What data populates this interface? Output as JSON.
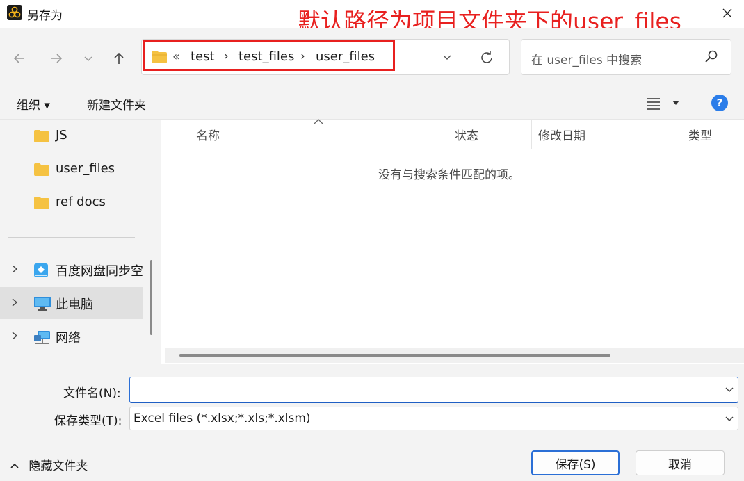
{
  "window": {
    "title": "另存为",
    "close_label": "✕"
  },
  "annotation": {
    "text": "默认路径为项目文件夹下的user_files",
    "color": "#e8201f"
  },
  "address": {
    "overflow": "«",
    "crumbs": [
      "test",
      "test_files",
      "user_files"
    ],
    "separator": "›"
  },
  "search": {
    "placeholder": "在 user_files 中搜索"
  },
  "toolbar": {
    "organize": "组织 ▾",
    "new_folder": "新建文件夹",
    "help": "?"
  },
  "sidebar": {
    "items": [
      {
        "label": "JS",
        "icon": "folder-icon"
      },
      {
        "label": "user_files",
        "icon": "folder-icon"
      },
      {
        "label": "ref docs",
        "icon": "folder-icon"
      },
      {
        "label": "百度网盘同步空",
        "icon": "baidu-sync-icon"
      },
      {
        "label": "此电脑",
        "icon": "computer-icon",
        "selected": true
      },
      {
        "label": "网络",
        "icon": "network-icon"
      }
    ]
  },
  "filelist": {
    "columns": [
      "名称",
      "状态",
      "修改日期",
      "类型"
    ],
    "empty_message": "没有与搜索条件匹配的项。"
  },
  "form": {
    "filename_label": "文件名(N):",
    "filename_value": "",
    "filetype_label": "保存类型(T):",
    "filetype_value": "Excel files (*.xlsx;*.xls;*.xlsm)"
  },
  "footer": {
    "hide_folders": "隐藏文件夹",
    "save": "保存(S)",
    "cancel": "取消"
  },
  "colors": {
    "accent": "#2b6fd6",
    "annotation": "#e8201f",
    "folder": "#f5c242"
  }
}
